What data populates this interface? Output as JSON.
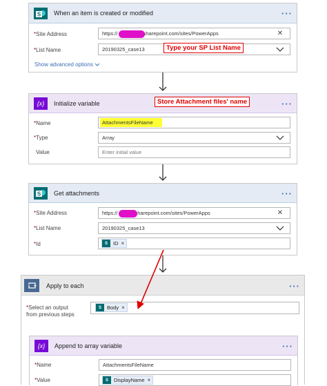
{
  "trigger": {
    "title": "When an item is created or modified",
    "more_label": "···",
    "site_address_label": "Site Address",
    "site_address_prefix": "https://",
    "site_address_value": "sharepoint.com/sites/PowerApps",
    "list_name_label": "List Name",
    "list_name_value": "20190325_case13",
    "show_advanced": "Show advanced options",
    "annotation": "Type your SP List Name"
  },
  "init_var": {
    "title": "Initialize variable",
    "more_label": "···",
    "annotation": "Store Attachment files' name",
    "name_label": "Name",
    "name_value": "AttachmentsFileName",
    "type_label": "Type",
    "type_value": "Array",
    "value_label": "Value",
    "value_placeholder": "Enter initial value"
  },
  "get_att": {
    "title": "Get attachments",
    "more_label": "···",
    "site_address_label": "Site Address",
    "site_address_prefix": "https://",
    "site_address_value": "sharepoint.com/sites/PowerApps",
    "list_name_label": "List Name",
    "list_name_value": "20190325_case13",
    "id_label": "Id",
    "id_token": "ID"
  },
  "apply": {
    "title": "Apply to each",
    "more_label": "···",
    "select_label_1": "Select an output",
    "select_label_2": "from previous steps",
    "body_token": "Body"
  },
  "append": {
    "title": "Append to array variable",
    "more_label": "···",
    "name_label": "Name",
    "name_value": "AttachmentsFileName",
    "value_label": "Value",
    "value_token": "DisplayName"
  },
  "symbols": {
    "required": "*",
    "token_close": "×",
    "clear": "✕",
    "fx_var": "{x}",
    "sp_letter": "S"
  },
  "colors": {
    "sharepoint": "#036c70",
    "variable": "#770bd6",
    "loop": "#486991",
    "annotation": "#e00000",
    "redaction": "#e010c8",
    "highlight": "#ffff33"
  }
}
